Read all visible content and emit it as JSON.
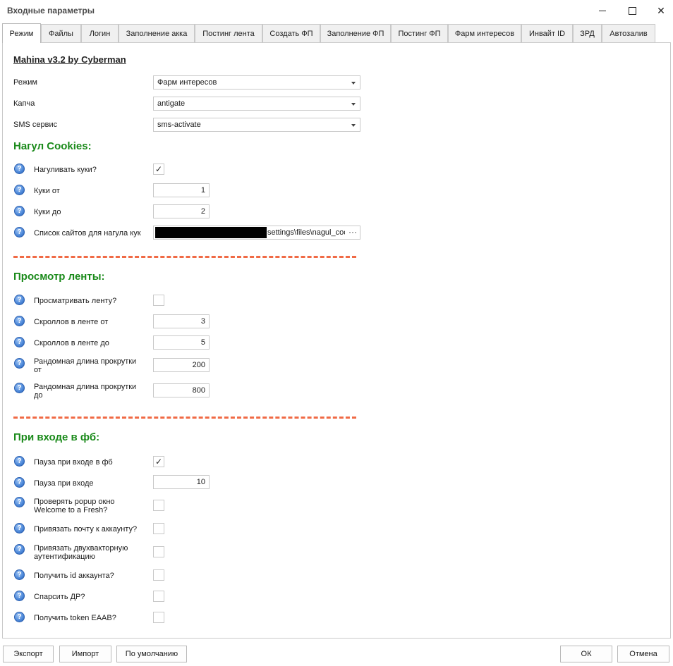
{
  "window": {
    "title": "Входные параметры"
  },
  "tabs": [
    "Режим",
    "Файлы",
    "Логин",
    "Заполнение акка",
    "Постинг лента",
    "Создать ФП",
    "Заполнение ФП",
    "Постинг ФП",
    "Фарм интересов",
    "Инвайт ID",
    "ЗРД",
    "Автозалив"
  ],
  "heading": "Mahina v3.2 by Cyberman",
  "settings": {
    "mode": {
      "label": "Режим",
      "value": "Фарм интересов"
    },
    "captcha": {
      "label": "Капча",
      "value": "antigate"
    },
    "sms": {
      "label": "SMS сервис",
      "value": "sms-activate"
    }
  },
  "cookies": {
    "title": "Нагул Cookies:",
    "enable": {
      "label": "Нагуливать куки?",
      "checked": true,
      "mark": "✓"
    },
    "from": {
      "label": "Куки от",
      "value": "1"
    },
    "to": {
      "label": "Куки до",
      "value": "2"
    },
    "sites": {
      "label": "Список сайтов для нагула кук",
      "value": "settings\\files\\nagul_coc",
      "button": "···"
    }
  },
  "feed": {
    "title": "Просмотр ленты:",
    "enable": {
      "label": "Просматривать ленту?",
      "checked": false
    },
    "scroll_from": {
      "label": "Скроллов в ленте от",
      "value": "3"
    },
    "scroll_to": {
      "label": "Скроллов в ленте до",
      "value": "5"
    },
    "len_from": {
      "label1": "Рандомная длина прокрутки",
      "label2": "от",
      "value": "200"
    },
    "len_to": {
      "label1": "Рандомная длина прокрутки",
      "label2": "до",
      "value": "800"
    }
  },
  "login": {
    "title": "При входе в фб:",
    "pause_enable": {
      "label": "Пауза при входе в фб",
      "checked": true,
      "mark": "✓"
    },
    "pause": {
      "label": "Пауза при входе",
      "value": "10"
    },
    "popup": {
      "label1": "Проверять popup окно",
      "label2": "Welcome to a Fresh?",
      "checked": false
    },
    "email": {
      "label": "Привязать почту к аккаунту?",
      "checked": false
    },
    "twofa": {
      "label1": "Привязать двухвакторную",
      "label2": "аутентификацию",
      "checked": false
    },
    "get_id": {
      "label": "Получить id аккаунта?",
      "checked": false
    },
    "parse_dr": {
      "label": "Спарсить ДР?",
      "checked": false
    },
    "token": {
      "label": "Получить token EAAB?",
      "checked": false
    }
  },
  "help_glyph": "?",
  "footer": {
    "export": "Экспорт",
    "import": "Импорт",
    "defaults": "По умолчанию",
    "ok": "ОК",
    "cancel": "Отмена"
  },
  "colors": {
    "section": "#1a8a1a",
    "divider": "#f06a45",
    "help": "#4a86d8"
  }
}
